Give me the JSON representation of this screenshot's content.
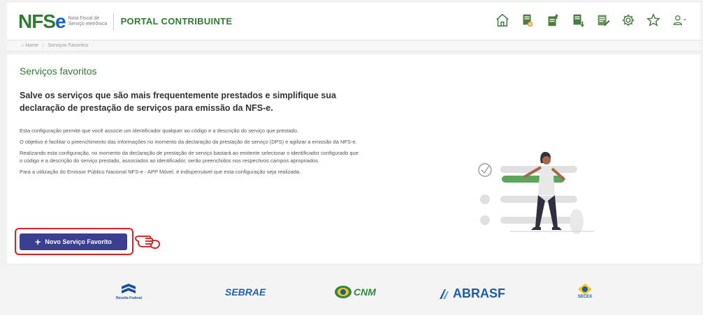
{
  "header": {
    "logo_main": "NFS",
    "logo_e": "e",
    "logo_sub": "Nota Fiscal de Serviço eletrônica",
    "portal_title": "PORTAL CONTRIBUINTE",
    "icons": [
      "home-icon",
      "emit-doc-icon",
      "upload-doc-icon",
      "download-doc-icon",
      "edit-doc-icon",
      "gear-icon",
      "star-icon",
      "user-icon"
    ]
  },
  "breadcrumb": {
    "home": "Home",
    "separator": "::",
    "current": "Serviços Favoritos"
  },
  "main": {
    "page_title": "Serviços favoritos",
    "headline": "Salve os serviços que são mais frequentemente prestados e simplifique sua declaração de prestação de serviços para emissão da NFS-e.",
    "paragraphs": [
      "Esta configuração permite que você associe um identificador qualquer ao código e a descrição do serviço que prestado.",
      "O objetivo é facilitar o preenchimento das informações no momento da declaração da prestação de serviço (DPS) e agilizar a emissão da NFS-e.",
      "Realizando esta configuração, no momento da declaração de prestação de serviço bastará ao emitente selecionar o identificador configurado que o código e a descrição do serviço prestado, associados ao identificador, serão preenchidos nos respectivos campos apropriados.",
      "Para a utilização do Emissor Público Nacional NFS-e - APP Móvel, é indispensável que esta configuração seja realizada."
    ],
    "new_button_label": "Novo Serviço Favorito"
  },
  "footer": {
    "partners": [
      {
        "name": "Receita Federal",
        "color": "#1a4f9c"
      },
      {
        "name": "SEBRAE",
        "color": "#1e62b0"
      },
      {
        "name": "CNM",
        "color": "#2d8a3e"
      },
      {
        "name": "ABRASF",
        "color": "#1d5da8"
      },
      {
        "name": "SECEX",
        "color": "#1d5da8"
      }
    ]
  },
  "colors": {
    "brand_green": "#2e7d32",
    "brand_blue": "#1565c0",
    "button": "#3b3f8f",
    "highlight": "#e02020"
  }
}
